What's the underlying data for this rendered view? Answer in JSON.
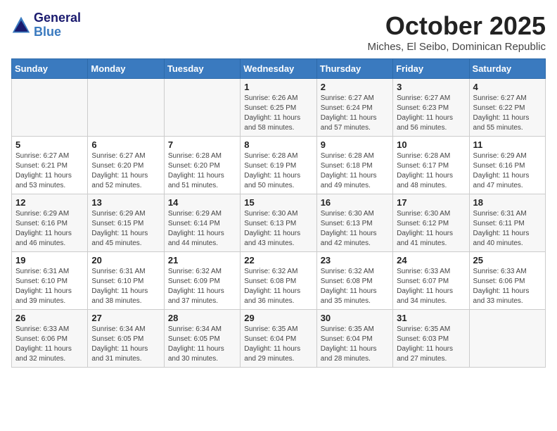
{
  "logo": {
    "line1": "General",
    "line2": "Blue"
  },
  "title": "October 2025",
  "subtitle": "Miches, El Seibo, Dominican Republic",
  "days_of_week": [
    "Sunday",
    "Monday",
    "Tuesday",
    "Wednesday",
    "Thursday",
    "Friday",
    "Saturday"
  ],
  "weeks": [
    [
      {
        "day": "",
        "sunrise": "",
        "sunset": "",
        "daylight": ""
      },
      {
        "day": "",
        "sunrise": "",
        "sunset": "",
        "daylight": ""
      },
      {
        "day": "",
        "sunrise": "",
        "sunset": "",
        "daylight": ""
      },
      {
        "day": "1",
        "sunrise": "Sunrise: 6:26 AM",
        "sunset": "Sunset: 6:25 PM",
        "daylight": "Daylight: 11 hours and 58 minutes."
      },
      {
        "day": "2",
        "sunrise": "Sunrise: 6:27 AM",
        "sunset": "Sunset: 6:24 PM",
        "daylight": "Daylight: 11 hours and 57 minutes."
      },
      {
        "day": "3",
        "sunrise": "Sunrise: 6:27 AM",
        "sunset": "Sunset: 6:23 PM",
        "daylight": "Daylight: 11 hours and 56 minutes."
      },
      {
        "day": "4",
        "sunrise": "Sunrise: 6:27 AM",
        "sunset": "Sunset: 6:22 PM",
        "daylight": "Daylight: 11 hours and 55 minutes."
      }
    ],
    [
      {
        "day": "5",
        "sunrise": "Sunrise: 6:27 AM",
        "sunset": "Sunset: 6:21 PM",
        "daylight": "Daylight: 11 hours and 53 minutes."
      },
      {
        "day": "6",
        "sunrise": "Sunrise: 6:27 AM",
        "sunset": "Sunset: 6:20 PM",
        "daylight": "Daylight: 11 hours and 52 minutes."
      },
      {
        "day": "7",
        "sunrise": "Sunrise: 6:28 AM",
        "sunset": "Sunset: 6:20 PM",
        "daylight": "Daylight: 11 hours and 51 minutes."
      },
      {
        "day": "8",
        "sunrise": "Sunrise: 6:28 AM",
        "sunset": "Sunset: 6:19 PM",
        "daylight": "Daylight: 11 hours and 50 minutes."
      },
      {
        "day": "9",
        "sunrise": "Sunrise: 6:28 AM",
        "sunset": "Sunset: 6:18 PM",
        "daylight": "Daylight: 11 hours and 49 minutes."
      },
      {
        "day": "10",
        "sunrise": "Sunrise: 6:28 AM",
        "sunset": "Sunset: 6:17 PM",
        "daylight": "Daylight: 11 hours and 48 minutes."
      },
      {
        "day": "11",
        "sunrise": "Sunrise: 6:29 AM",
        "sunset": "Sunset: 6:16 PM",
        "daylight": "Daylight: 11 hours and 47 minutes."
      }
    ],
    [
      {
        "day": "12",
        "sunrise": "Sunrise: 6:29 AM",
        "sunset": "Sunset: 6:16 PM",
        "daylight": "Daylight: 11 hours and 46 minutes."
      },
      {
        "day": "13",
        "sunrise": "Sunrise: 6:29 AM",
        "sunset": "Sunset: 6:15 PM",
        "daylight": "Daylight: 11 hours and 45 minutes."
      },
      {
        "day": "14",
        "sunrise": "Sunrise: 6:29 AM",
        "sunset": "Sunset: 6:14 PM",
        "daylight": "Daylight: 11 hours and 44 minutes."
      },
      {
        "day": "15",
        "sunrise": "Sunrise: 6:30 AM",
        "sunset": "Sunset: 6:13 PM",
        "daylight": "Daylight: 11 hours and 43 minutes."
      },
      {
        "day": "16",
        "sunrise": "Sunrise: 6:30 AM",
        "sunset": "Sunset: 6:13 PM",
        "daylight": "Daylight: 11 hours and 42 minutes."
      },
      {
        "day": "17",
        "sunrise": "Sunrise: 6:30 AM",
        "sunset": "Sunset: 6:12 PM",
        "daylight": "Daylight: 11 hours and 41 minutes."
      },
      {
        "day": "18",
        "sunrise": "Sunrise: 6:31 AM",
        "sunset": "Sunset: 6:11 PM",
        "daylight": "Daylight: 11 hours and 40 minutes."
      }
    ],
    [
      {
        "day": "19",
        "sunrise": "Sunrise: 6:31 AM",
        "sunset": "Sunset: 6:10 PM",
        "daylight": "Daylight: 11 hours and 39 minutes."
      },
      {
        "day": "20",
        "sunrise": "Sunrise: 6:31 AM",
        "sunset": "Sunset: 6:10 PM",
        "daylight": "Daylight: 11 hours and 38 minutes."
      },
      {
        "day": "21",
        "sunrise": "Sunrise: 6:32 AM",
        "sunset": "Sunset: 6:09 PM",
        "daylight": "Daylight: 11 hours and 37 minutes."
      },
      {
        "day": "22",
        "sunrise": "Sunrise: 6:32 AM",
        "sunset": "Sunset: 6:08 PM",
        "daylight": "Daylight: 11 hours and 36 minutes."
      },
      {
        "day": "23",
        "sunrise": "Sunrise: 6:32 AM",
        "sunset": "Sunset: 6:08 PM",
        "daylight": "Daylight: 11 hours and 35 minutes."
      },
      {
        "day": "24",
        "sunrise": "Sunrise: 6:33 AM",
        "sunset": "Sunset: 6:07 PM",
        "daylight": "Daylight: 11 hours and 34 minutes."
      },
      {
        "day": "25",
        "sunrise": "Sunrise: 6:33 AM",
        "sunset": "Sunset: 6:06 PM",
        "daylight": "Daylight: 11 hours and 33 minutes."
      }
    ],
    [
      {
        "day": "26",
        "sunrise": "Sunrise: 6:33 AM",
        "sunset": "Sunset: 6:06 PM",
        "daylight": "Daylight: 11 hours and 32 minutes."
      },
      {
        "day": "27",
        "sunrise": "Sunrise: 6:34 AM",
        "sunset": "Sunset: 6:05 PM",
        "daylight": "Daylight: 11 hours and 31 minutes."
      },
      {
        "day": "28",
        "sunrise": "Sunrise: 6:34 AM",
        "sunset": "Sunset: 6:05 PM",
        "daylight": "Daylight: 11 hours and 30 minutes."
      },
      {
        "day": "29",
        "sunrise": "Sunrise: 6:35 AM",
        "sunset": "Sunset: 6:04 PM",
        "daylight": "Daylight: 11 hours and 29 minutes."
      },
      {
        "day": "30",
        "sunrise": "Sunrise: 6:35 AM",
        "sunset": "Sunset: 6:04 PM",
        "daylight": "Daylight: 11 hours and 28 minutes."
      },
      {
        "day": "31",
        "sunrise": "Sunrise: 6:35 AM",
        "sunset": "Sunset: 6:03 PM",
        "daylight": "Daylight: 11 hours and 27 minutes."
      },
      {
        "day": "",
        "sunrise": "",
        "sunset": "",
        "daylight": ""
      }
    ]
  ]
}
